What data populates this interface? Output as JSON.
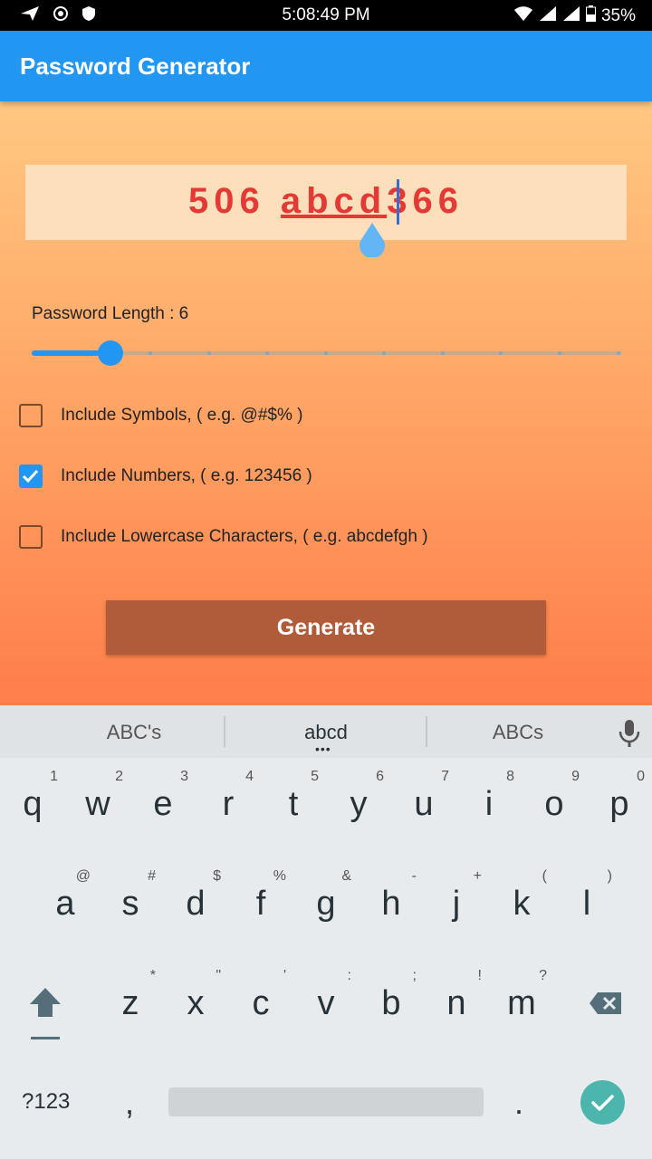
{
  "status_bar": {
    "time": "5:08:49 PM",
    "battery": "35%",
    "icons_left": [
      "send-icon",
      "circle-target-icon",
      "shield-icon"
    ],
    "icons_right": [
      "wifi-icon",
      "signal-icon",
      "signal-roaming-icon",
      "battery-icon"
    ]
  },
  "app_bar": {
    "title": "Password Generator"
  },
  "password": {
    "part1": "506",
    "part2": "abcd",
    "part3": "366",
    "text_color": "#e53935"
  },
  "length": {
    "label": "Password Length : 6",
    "value": 6,
    "min": 4,
    "max": 24
  },
  "options": [
    {
      "label": "Include Symbols, ( e.g. @#$% )",
      "checked": false
    },
    {
      "label": "Include Numbers, ( e.g. 123456 )",
      "checked": true
    },
    {
      "label": "Include Lowercase Characters, ( e.g. abcdefgh )",
      "checked": false
    }
  ],
  "generate_label": "Generate",
  "keyboard": {
    "suggestions": [
      "ABC's",
      "abcd",
      "ABCs"
    ],
    "row1": [
      {
        "ch": "q",
        "hint": "1"
      },
      {
        "ch": "w",
        "hint": "2"
      },
      {
        "ch": "e",
        "hint": "3"
      },
      {
        "ch": "r",
        "hint": "4"
      },
      {
        "ch": "t",
        "hint": "5"
      },
      {
        "ch": "y",
        "hint": "6"
      },
      {
        "ch": "u",
        "hint": "7"
      },
      {
        "ch": "i",
        "hint": "8"
      },
      {
        "ch": "o",
        "hint": "9"
      },
      {
        "ch": "p",
        "hint": "0"
      }
    ],
    "row2": [
      {
        "ch": "a",
        "hint": "@"
      },
      {
        "ch": "s",
        "hint": "#"
      },
      {
        "ch": "d",
        "hint": "$"
      },
      {
        "ch": "f",
        "hint": "%"
      },
      {
        "ch": "g",
        "hint": "&"
      },
      {
        "ch": "h",
        "hint": "-"
      },
      {
        "ch": "j",
        "hint": "+"
      },
      {
        "ch": "k",
        "hint": "("
      },
      {
        "ch": "l",
        "hint": ")"
      }
    ],
    "row3": [
      {
        "ch": "z",
        "hint": "*"
      },
      {
        "ch": "x",
        "hint": "\""
      },
      {
        "ch": "c",
        "hint": "'"
      },
      {
        "ch": "v",
        "hint": ":"
      },
      {
        "ch": "b",
        "hint": ";"
      },
      {
        "ch": "n",
        "hint": "!"
      },
      {
        "ch": "m",
        "hint": "?"
      }
    ],
    "symbols_key": "?123",
    "comma_key": ",",
    "period_key": "."
  },
  "colors": {
    "app_bar": "#2196f3",
    "button": "#b05c3b",
    "enter": "#4db6ac"
  }
}
